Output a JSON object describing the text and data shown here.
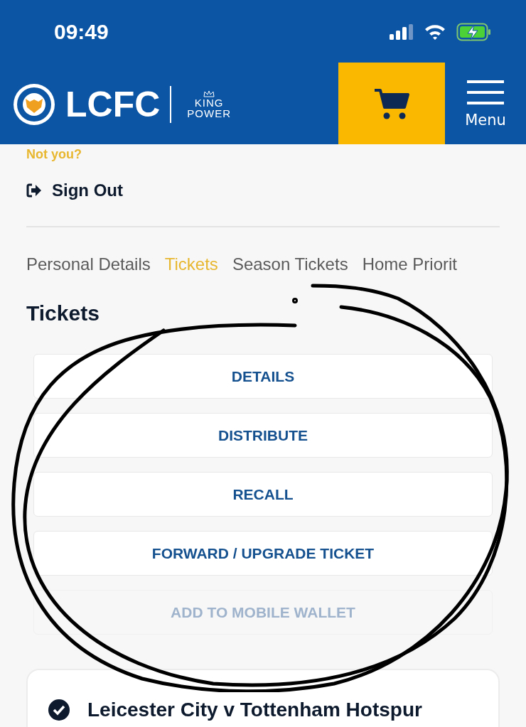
{
  "status_bar": {
    "time": "09:49"
  },
  "header": {
    "logo_text": "LCFC",
    "sponsor_top": "KING",
    "sponsor_bottom": "POWER",
    "menu_label": "Menu"
  },
  "account": {
    "not_you": "Not you?",
    "sign_out": "Sign Out"
  },
  "tabs": [
    {
      "label": "Personal Details",
      "selected": false
    },
    {
      "label": "Tickets",
      "selected": true
    },
    {
      "label": "Season Tickets",
      "selected": false
    },
    {
      "label": "Home Priorit",
      "selected": false
    }
  ],
  "section_title": "Tickets",
  "actions": [
    {
      "label": "DETAILS",
      "disabled": false
    },
    {
      "label": "DISTRIBUTE",
      "disabled": false
    },
    {
      "label": "RECALL",
      "disabled": false
    },
    {
      "label": "FORWARD / UPGRADE TICKET",
      "disabled": false
    },
    {
      "label": "ADD TO MOBILE WALLET",
      "disabled": true
    }
  ],
  "matches": [
    {
      "title": "Leicester City v Tottenham Hotspur",
      "checked": true
    }
  ]
}
